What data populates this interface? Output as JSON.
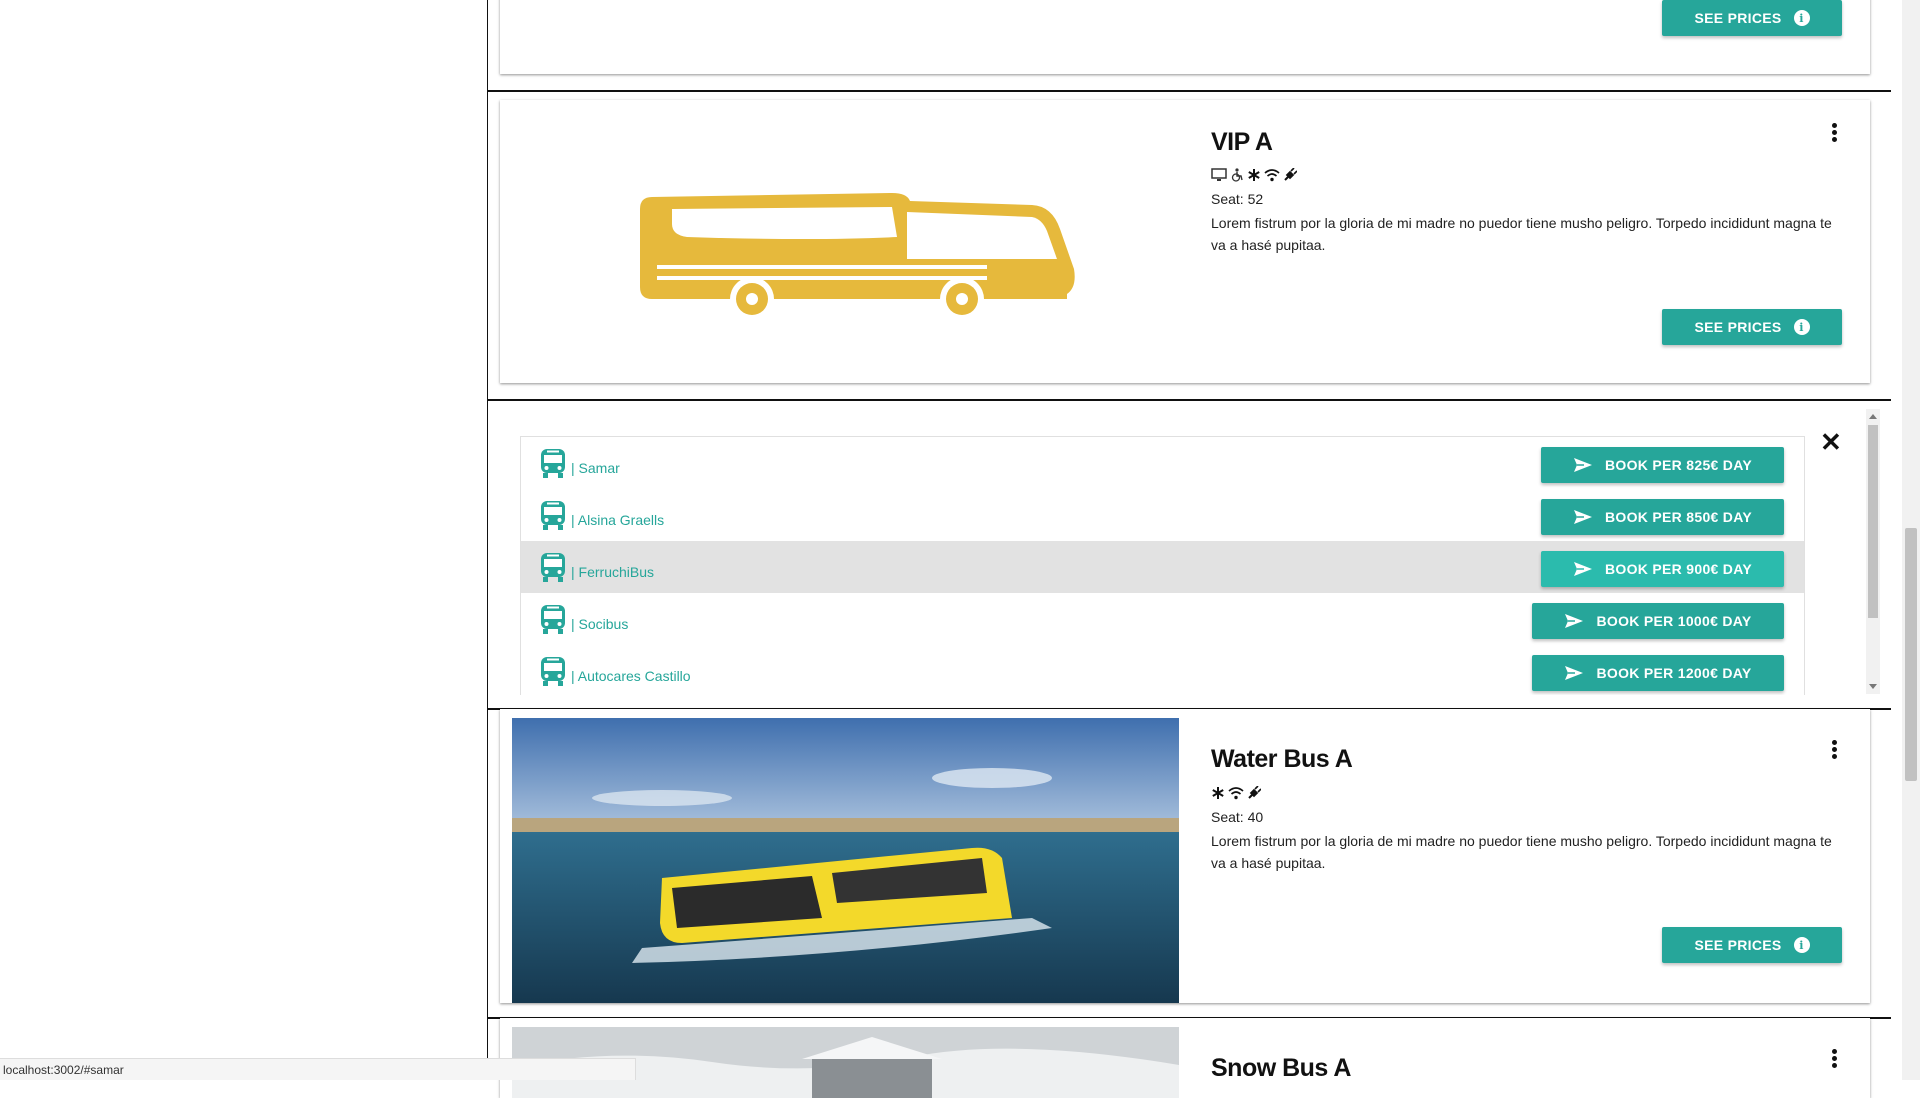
{
  "status_url": "localhost:3002/#samar",
  "buses": [
    {
      "id": "prev",
      "see_prices_label": "SEE PRICES"
    },
    {
      "id": "vip-a",
      "title": "VIP A",
      "amenities": [
        "tv-icon",
        "wheelchair-icon",
        "snowflake-icon",
        "wifi-icon",
        "plug-icon"
      ],
      "seat": "Seat: 52",
      "description": "Lorem fistrum por la gloria de mi madre no puedor tiene musho peligro. Torpedo incididunt magna te va a hasé pupitaa.",
      "see_prices_label": "SEE PRICES"
    },
    {
      "id": "water-bus-a",
      "title": "Water Bus A",
      "amenities": [
        "snowflake-icon",
        "wifi-icon",
        "plug-icon"
      ],
      "seat": "Seat: 40",
      "description": "Lorem fistrum por la gloria de mi madre no puedor tiene musho peligro. Torpedo incididunt magna te va a hasé pupitaa.",
      "see_prices_label": "SEE PRICES"
    },
    {
      "id": "snow-bus-a",
      "title": "Snow Bus A"
    }
  ],
  "offers": [
    {
      "operator": "| Samar",
      "book_label": "BOOK PER 825€ DAY"
    },
    {
      "operator": "| Alsina Graells",
      "book_label": "BOOK PER 850€ DAY"
    },
    {
      "operator": "| FerruchiBus",
      "book_label": "BOOK PER 900€ DAY"
    },
    {
      "operator": "| Socibus",
      "book_label": "BOOK PER 1000€ DAY"
    },
    {
      "operator": "| Autocares Castillo",
      "book_label": "BOOK PER 1200€ DAY"
    }
  ],
  "colors": {
    "accent": "#26a69a",
    "accent_hover": "#2bbbad",
    "bus_yellow": "#e6b93c"
  }
}
